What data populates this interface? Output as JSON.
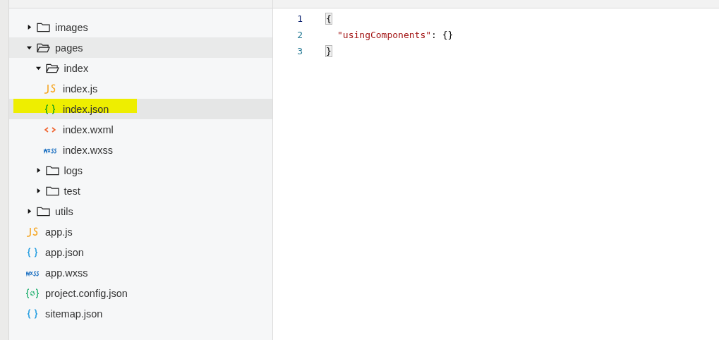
{
  "tree": [
    {
      "kind": "folder",
      "name": "images",
      "expanded": false,
      "selected": false
    },
    {
      "kind": "folder",
      "name": "pages",
      "expanded": true,
      "hover": true,
      "selected": false,
      "children": [
        {
          "kind": "folder",
          "name": "index",
          "expanded": true,
          "selected": false,
          "children": [
            {
              "kind": "js",
              "name": "index.js",
              "selected": false
            },
            {
              "kind": "json",
              "name": "index.json",
              "selected": true,
              "marked": true
            },
            {
              "kind": "wxml",
              "name": "index.wxml",
              "selected": false
            },
            {
              "kind": "wxss",
              "name": "index.wxss",
              "selected": false
            }
          ]
        },
        {
          "kind": "folder",
          "name": "logs",
          "expanded": false,
          "selected": false
        },
        {
          "kind": "folder",
          "name": "test",
          "expanded": false,
          "selected": false
        }
      ]
    },
    {
      "kind": "folder",
      "name": "utils",
      "expanded": false,
      "selected": false
    },
    {
      "kind": "js",
      "name": "app.js",
      "selected": false
    },
    {
      "kind": "json-app",
      "name": "app.json",
      "selected": false
    },
    {
      "kind": "wxss",
      "name": "app.wxss",
      "selected": false
    },
    {
      "kind": "config",
      "name": "project.config.json",
      "selected": false
    },
    {
      "kind": "json-app",
      "name": "sitemap.json",
      "selected": false
    }
  ],
  "editor": {
    "lines": [
      {
        "number": "1",
        "indented": false,
        "tokens": [
          {
            "kind": "bracket-match",
            "text": "{"
          }
        ]
      },
      {
        "number": "2",
        "indented": true,
        "tokens": [
          {
            "kind": "key",
            "text": "\"usingComponents\""
          },
          {
            "kind": "plain",
            "text": ": {}"
          }
        ]
      },
      {
        "number": "3",
        "indented": false,
        "tokens": [
          {
            "kind": "bracket-match",
            "text": "}"
          }
        ]
      }
    ]
  }
}
